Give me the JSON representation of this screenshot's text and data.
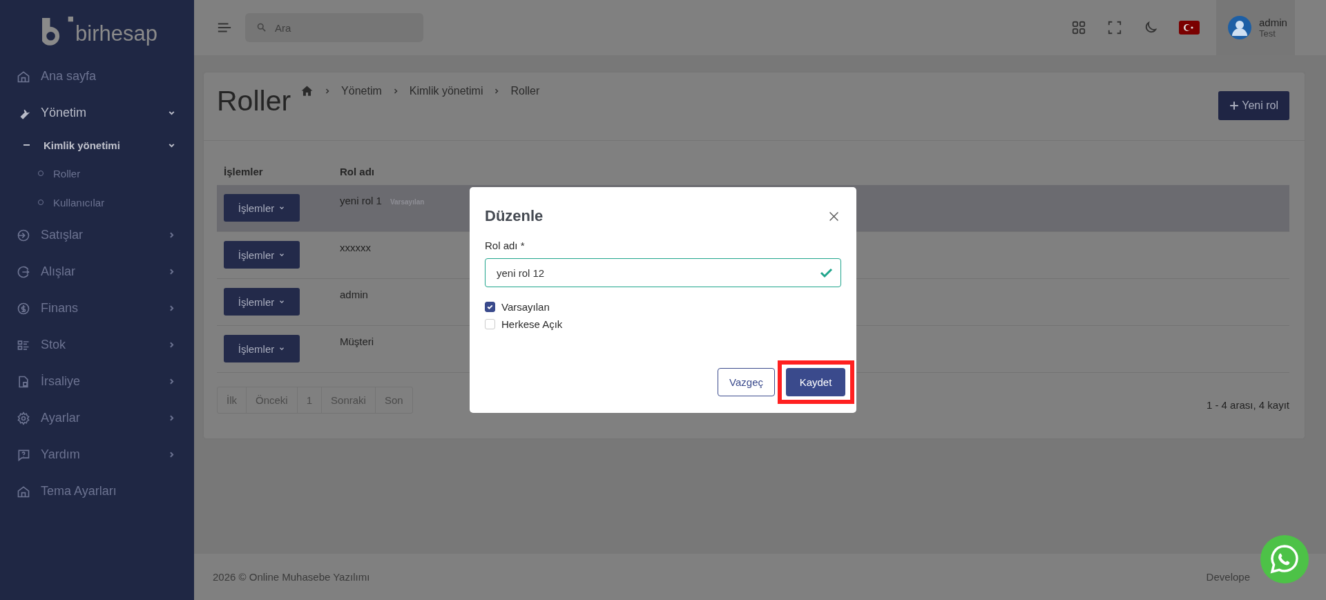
{
  "sidebar": {
    "logo_text": "birhesap",
    "items": [
      {
        "label": "Ana sayfa",
        "kind": "link"
      },
      {
        "label": "Yönetim",
        "kind": "group",
        "expanded": true,
        "children": [
          {
            "label": "Kimlik yönetimi",
            "kind": "group",
            "expanded": true,
            "children": [
              {
                "label": "Roller"
              },
              {
                "label": "Kullanıcılar"
              }
            ]
          }
        ]
      },
      {
        "label": "Satışlar",
        "kind": "group",
        "expanded": false
      },
      {
        "label": "Alışlar",
        "kind": "group",
        "expanded": false
      },
      {
        "label": "Finans",
        "kind": "group",
        "expanded": false
      },
      {
        "label": "Stok",
        "kind": "group",
        "expanded": false
      },
      {
        "label": "İrsaliye",
        "kind": "group",
        "expanded": false
      },
      {
        "label": "Ayarlar",
        "kind": "group",
        "expanded": false
      },
      {
        "label": "Yardım",
        "kind": "group",
        "expanded": false
      },
      {
        "label": "Tema Ayarları",
        "kind": "link"
      }
    ]
  },
  "topbar": {
    "search": {
      "placeholder": "Ara"
    },
    "user": {
      "name": "admin",
      "role": "Test"
    }
  },
  "page": {
    "title": "Roller",
    "breadcrumb": [
      "Yönetim",
      "Kimlik yönetimi",
      "Roller"
    ],
    "new_button": "Yeni rol"
  },
  "table": {
    "columns": [
      "İşlemler",
      "Rol adı"
    ],
    "rows": [
      {
        "action": "İşlemler",
        "name": "yeni rol 1",
        "badge": "Varsayılan",
        "selected": true
      },
      {
        "action": "İşlemler",
        "name": "xxxxxx",
        "selected": false
      },
      {
        "action": "İşlemler",
        "name": "admin",
        "selected": false
      },
      {
        "action": "İşlemler",
        "name": "Müşteri",
        "selected": false
      }
    ]
  },
  "pagination": {
    "pages": [
      "İlk",
      "Önceki",
      "1",
      "Sonraki",
      "Son"
    ],
    "summary": "1 - 4 arası, 4 kayıt"
  },
  "modal": {
    "title": "Düzenle",
    "field": {
      "label": "Rol adı *",
      "value": "yeni rol 12",
      "valid": true
    },
    "checkboxes": [
      {
        "label": "Varsayılan",
        "checked": true
      },
      {
        "label": "Herkese Açık",
        "checked": false
      }
    ],
    "buttons": [
      {
        "label": "Vazgeç",
        "kind": "secondary",
        "highlighted": false
      },
      {
        "label": "Kaydet",
        "kind": "primary",
        "highlighted": true
      }
    ]
  },
  "footer": {
    "copyright": "2026 © Online Muhasebe Yazılımı",
    "credit": "Develope"
  }
}
